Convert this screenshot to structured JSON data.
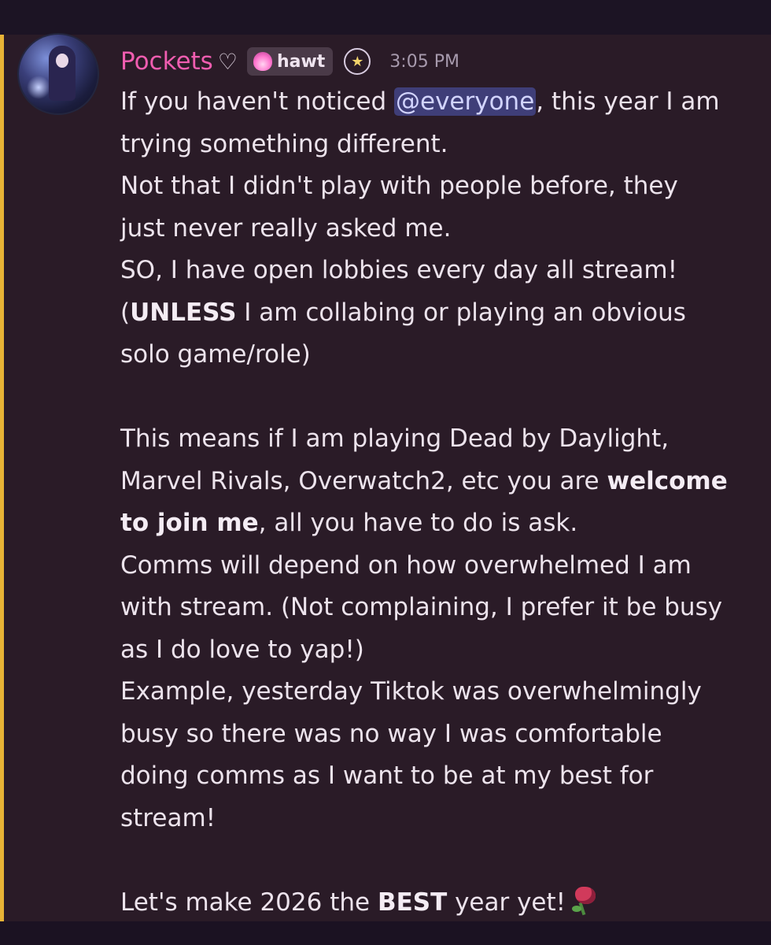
{
  "message": {
    "author": {
      "name": "Pockets",
      "name_suffix": "♡",
      "role_tag": "hawt",
      "role_tag_icon": "pink-flame-icon",
      "badge_icon": "crescent-star-badge-icon",
      "avatar": "avatar-image"
    },
    "timestamp": "3:05 PM",
    "accent_color": "#e7b336",
    "username_color": "#f05db0",
    "lines": {
      "l1a": "If you haven't noticed ",
      "l1_mention": "@everyone",
      "l1b": ", this year I am",
      "l2": "trying something different.",
      "l3": "Not that I didn't play with people before, they",
      "l4": "just never really asked me.",
      "l5": "SO, I have open lobbies every day all stream!",
      "l6a": "(",
      "l6_bold": "UNLESS",
      "l6b": " I am collabing or playing an obvious",
      "l7": "solo game/role)",
      "l8": "This means if I am playing Dead by Daylight,",
      "l9a": "Marvel Rivals, Overwatch2, etc you are ",
      "l9_bold": "welcome",
      "l10_bold": "to join me",
      "l10b": ", all you have to do is ask.",
      "l11": "Comms will depend on how overwhelmed I am",
      "l12": "with stream. (Not complaining, I prefer it be busy",
      "l13": "as I do love to yap!)",
      "l14": "Example, yesterday Tiktok was overwhelmingly",
      "l15": "busy so there was no way I was comfortable",
      "l16": "doing comms as I want to be at my best for",
      "l17": "stream!",
      "l18a": "Let's make 2026 the ",
      "l18_bold": "BEST",
      "l18b": " year yet!",
      "l18_emoji": "rose-emoji"
    }
  }
}
